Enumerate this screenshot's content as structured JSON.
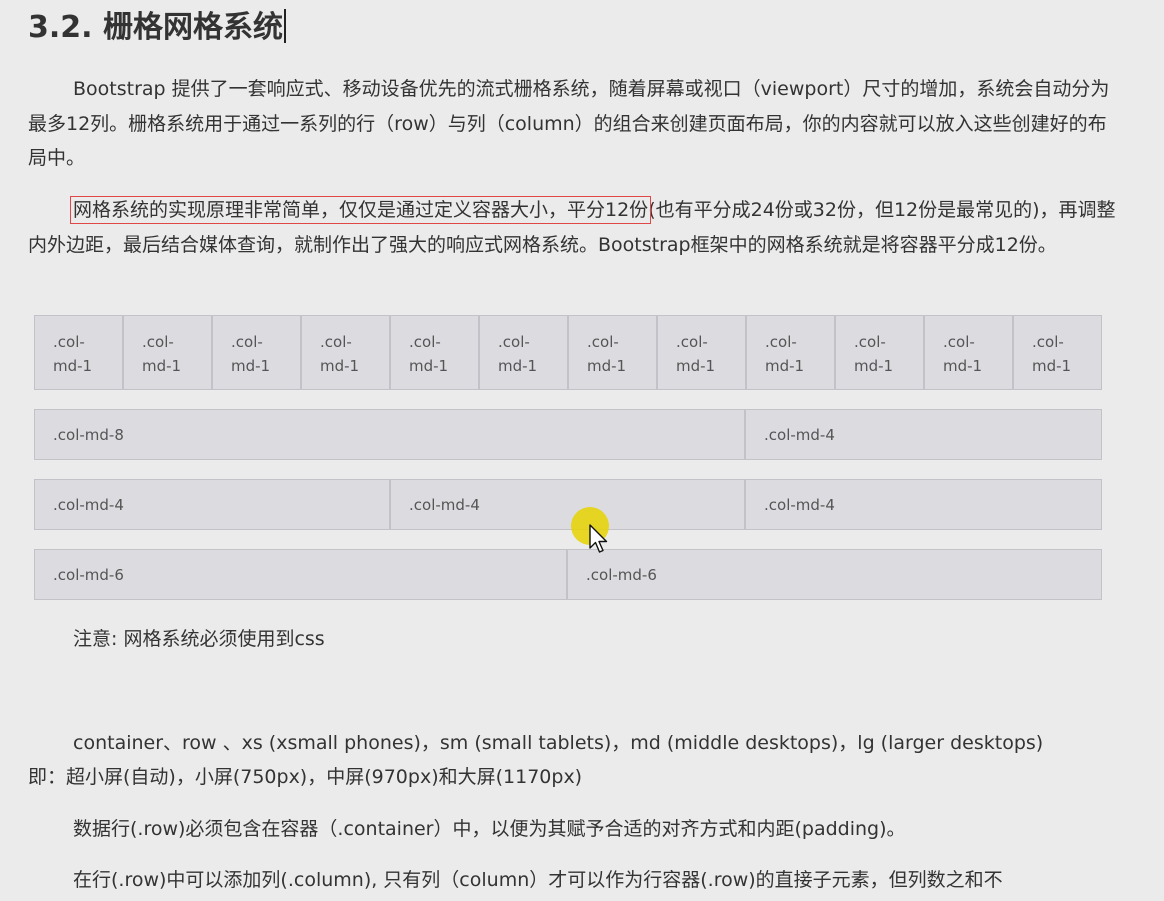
{
  "heading": "3.2. 栅格网格系统",
  "paragraph1": "Bootstrap 提供了一套响应式、移动设备优先的流式栅格系统，随着屏幕或视口（viewport）尺寸的增加，系统会自动分为最多12列。栅格系统用于通过一系列的行（row）与列（column）的组合来创建页面布局，你的内容就可以放入这些创建好的布局中。",
  "paragraph2": {
    "highlighted": "网格系统的实现原理非常简单，仅仅是通过定义容器大小，平分12份",
    "rest": "(也有平分成24份或32份，但12份是最常见的)，再调整内外边距，最后结合媒体查询，就制作出了强大的响应式网格系统。Bootstrap框架中的网格系统就是将容器平分成12份。"
  },
  "grid_demo": {
    "row12": [
      {
        "line1": ".col-",
        "line2": "md-1"
      },
      {
        "line1": ".col-",
        "line2": "md-1"
      },
      {
        "line1": ".col-",
        "line2": "md-1"
      },
      {
        "line1": ".col-",
        "line2": "md-1"
      },
      {
        "line1": ".col-",
        "line2": "md-1"
      },
      {
        "line1": ".col-",
        "line2": "md-1"
      },
      {
        "line1": ".col-",
        "line2": "md-1"
      },
      {
        "line1": ".col-",
        "line2": "md-1"
      },
      {
        "line1": ".col-",
        "line2": "md-1"
      },
      {
        "line1": ".col-",
        "line2": "md-1"
      },
      {
        "line1": ".col-",
        "line2": "md-1"
      },
      {
        "line1": ".col-",
        "line2": "md-1"
      }
    ],
    "row_8_4": [
      ".col-md-8",
      ".col-md-4"
    ],
    "row_4_4_4": [
      ".col-md-4",
      ".col-md-4",
      ".col-md-4"
    ],
    "row_6_6": [
      ".col-md-6",
      ".col-md-6"
    ],
    "colors": {
      "cell_bg": "#dcdbe0",
      "cell_border": "#c3c2c9"
    }
  },
  "note": "注意: 网格系统必须使用到css",
  "line_a": "container、row 、xs (xsmall phones)，sm (small tablets)，md (middle desktops)，lg (larger desktops)",
  "line_b": "即：超小屏(自动)，小屏(750px)，中屏(970px)和大屏(1170px)",
  "line_c": "数据行(.row)必须包含在容器（.container）中，以便为其赋予合适的对齐方式和内距(padding)。",
  "line_d": "在行(.row)中可以添加列(.column), 只有列（column）才可以作为行容器(.row)的直接子元素，但列数之和不",
  "colors": {
    "page_bg": "#ebebeb",
    "text": "#333333",
    "highlight_box": "#e04848",
    "cursor_halo": "#e6d200"
  },
  "icons": {
    "cursor": "mouse-pointer-icon"
  }
}
